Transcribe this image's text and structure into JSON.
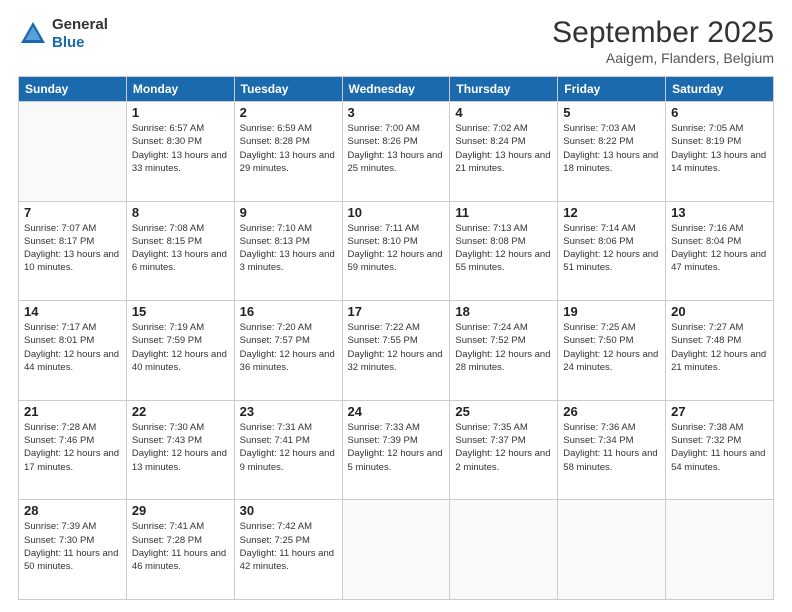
{
  "logo": {
    "general": "General",
    "blue": "Blue"
  },
  "header": {
    "month": "September 2025",
    "location": "Aaigem, Flanders, Belgium"
  },
  "weekdays": [
    "Sunday",
    "Monday",
    "Tuesday",
    "Wednesday",
    "Thursday",
    "Friday",
    "Saturday"
  ],
  "weeks": [
    [
      {
        "day": "",
        "sunrise": "",
        "sunset": "",
        "daylight": ""
      },
      {
        "day": "1",
        "sunrise": "Sunrise: 6:57 AM",
        "sunset": "Sunset: 8:30 PM",
        "daylight": "Daylight: 13 hours and 33 minutes."
      },
      {
        "day": "2",
        "sunrise": "Sunrise: 6:59 AM",
        "sunset": "Sunset: 8:28 PM",
        "daylight": "Daylight: 13 hours and 29 minutes."
      },
      {
        "day": "3",
        "sunrise": "Sunrise: 7:00 AM",
        "sunset": "Sunset: 8:26 PM",
        "daylight": "Daylight: 13 hours and 25 minutes."
      },
      {
        "day": "4",
        "sunrise": "Sunrise: 7:02 AM",
        "sunset": "Sunset: 8:24 PM",
        "daylight": "Daylight: 13 hours and 21 minutes."
      },
      {
        "day": "5",
        "sunrise": "Sunrise: 7:03 AM",
        "sunset": "Sunset: 8:22 PM",
        "daylight": "Daylight: 13 hours and 18 minutes."
      },
      {
        "day": "6",
        "sunrise": "Sunrise: 7:05 AM",
        "sunset": "Sunset: 8:19 PM",
        "daylight": "Daylight: 13 hours and 14 minutes."
      }
    ],
    [
      {
        "day": "7",
        "sunrise": "Sunrise: 7:07 AM",
        "sunset": "Sunset: 8:17 PM",
        "daylight": "Daylight: 13 hours and 10 minutes."
      },
      {
        "day": "8",
        "sunrise": "Sunrise: 7:08 AM",
        "sunset": "Sunset: 8:15 PM",
        "daylight": "Daylight: 13 hours and 6 minutes."
      },
      {
        "day": "9",
        "sunrise": "Sunrise: 7:10 AM",
        "sunset": "Sunset: 8:13 PM",
        "daylight": "Daylight: 13 hours and 3 minutes."
      },
      {
        "day": "10",
        "sunrise": "Sunrise: 7:11 AM",
        "sunset": "Sunset: 8:10 PM",
        "daylight": "Daylight: 12 hours and 59 minutes."
      },
      {
        "day": "11",
        "sunrise": "Sunrise: 7:13 AM",
        "sunset": "Sunset: 8:08 PM",
        "daylight": "Daylight: 12 hours and 55 minutes."
      },
      {
        "day": "12",
        "sunrise": "Sunrise: 7:14 AM",
        "sunset": "Sunset: 8:06 PM",
        "daylight": "Daylight: 12 hours and 51 minutes."
      },
      {
        "day": "13",
        "sunrise": "Sunrise: 7:16 AM",
        "sunset": "Sunset: 8:04 PM",
        "daylight": "Daylight: 12 hours and 47 minutes."
      }
    ],
    [
      {
        "day": "14",
        "sunrise": "Sunrise: 7:17 AM",
        "sunset": "Sunset: 8:01 PM",
        "daylight": "Daylight: 12 hours and 44 minutes."
      },
      {
        "day": "15",
        "sunrise": "Sunrise: 7:19 AM",
        "sunset": "Sunset: 7:59 PM",
        "daylight": "Daylight: 12 hours and 40 minutes."
      },
      {
        "day": "16",
        "sunrise": "Sunrise: 7:20 AM",
        "sunset": "Sunset: 7:57 PM",
        "daylight": "Daylight: 12 hours and 36 minutes."
      },
      {
        "day": "17",
        "sunrise": "Sunrise: 7:22 AM",
        "sunset": "Sunset: 7:55 PM",
        "daylight": "Daylight: 12 hours and 32 minutes."
      },
      {
        "day": "18",
        "sunrise": "Sunrise: 7:24 AM",
        "sunset": "Sunset: 7:52 PM",
        "daylight": "Daylight: 12 hours and 28 minutes."
      },
      {
        "day": "19",
        "sunrise": "Sunrise: 7:25 AM",
        "sunset": "Sunset: 7:50 PM",
        "daylight": "Daylight: 12 hours and 24 minutes."
      },
      {
        "day": "20",
        "sunrise": "Sunrise: 7:27 AM",
        "sunset": "Sunset: 7:48 PM",
        "daylight": "Daylight: 12 hours and 21 minutes."
      }
    ],
    [
      {
        "day": "21",
        "sunrise": "Sunrise: 7:28 AM",
        "sunset": "Sunset: 7:46 PM",
        "daylight": "Daylight: 12 hours and 17 minutes."
      },
      {
        "day": "22",
        "sunrise": "Sunrise: 7:30 AM",
        "sunset": "Sunset: 7:43 PM",
        "daylight": "Daylight: 12 hours and 13 minutes."
      },
      {
        "day": "23",
        "sunrise": "Sunrise: 7:31 AM",
        "sunset": "Sunset: 7:41 PM",
        "daylight": "Daylight: 12 hours and 9 minutes."
      },
      {
        "day": "24",
        "sunrise": "Sunrise: 7:33 AM",
        "sunset": "Sunset: 7:39 PM",
        "daylight": "Daylight: 12 hours and 5 minutes."
      },
      {
        "day": "25",
        "sunrise": "Sunrise: 7:35 AM",
        "sunset": "Sunset: 7:37 PM",
        "daylight": "Daylight: 12 hours and 2 minutes."
      },
      {
        "day": "26",
        "sunrise": "Sunrise: 7:36 AM",
        "sunset": "Sunset: 7:34 PM",
        "daylight": "Daylight: 11 hours and 58 minutes."
      },
      {
        "day": "27",
        "sunrise": "Sunrise: 7:38 AM",
        "sunset": "Sunset: 7:32 PM",
        "daylight": "Daylight: 11 hours and 54 minutes."
      }
    ],
    [
      {
        "day": "28",
        "sunrise": "Sunrise: 7:39 AM",
        "sunset": "Sunset: 7:30 PM",
        "daylight": "Daylight: 11 hours and 50 minutes."
      },
      {
        "day": "29",
        "sunrise": "Sunrise: 7:41 AM",
        "sunset": "Sunset: 7:28 PM",
        "daylight": "Daylight: 11 hours and 46 minutes."
      },
      {
        "day": "30",
        "sunrise": "Sunrise: 7:42 AM",
        "sunset": "Sunset: 7:25 PM",
        "daylight": "Daylight: 11 hours and 42 minutes."
      },
      {
        "day": "",
        "sunrise": "",
        "sunset": "",
        "daylight": ""
      },
      {
        "day": "",
        "sunrise": "",
        "sunset": "",
        "daylight": ""
      },
      {
        "day": "",
        "sunrise": "",
        "sunset": "",
        "daylight": ""
      },
      {
        "day": "",
        "sunrise": "",
        "sunset": "",
        "daylight": ""
      }
    ]
  ]
}
